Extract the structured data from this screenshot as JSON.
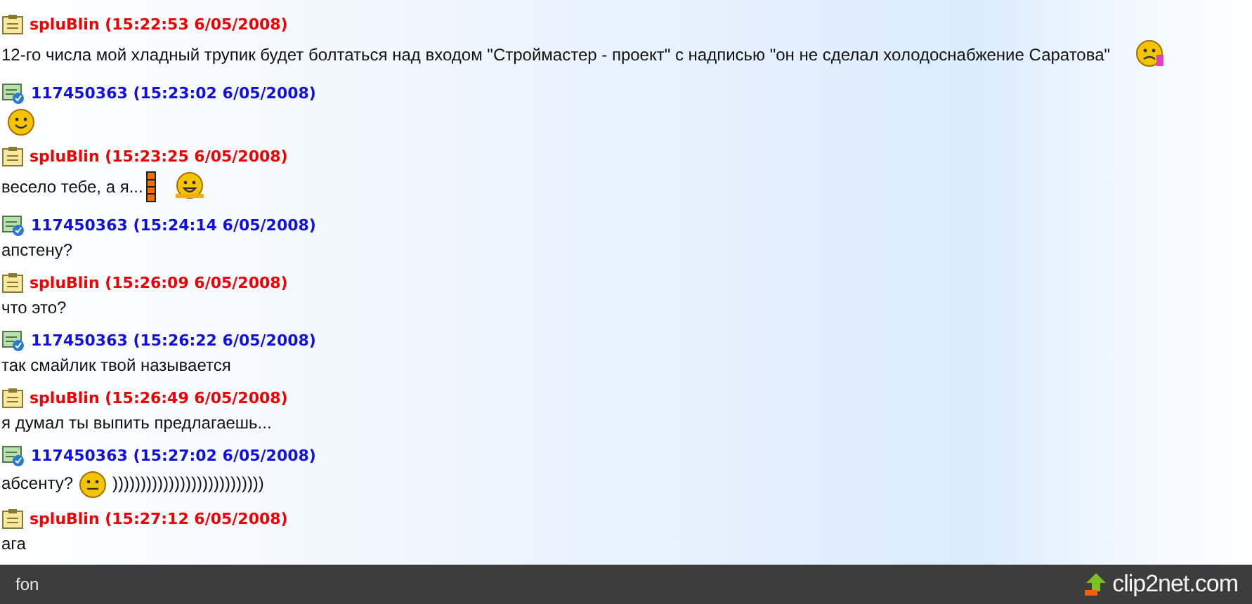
{
  "messages": [
    {
      "kind": "own",
      "header": "spluBlin (15:22:53 6/05/2008)",
      "parts": [
        {
          "kind": "text",
          "text": "12-го числа мой хладный трупик будет болтаться над входом \"Строймастер - проект\" с надписью \"он не сделал холодоснабжение Саратова\""
        },
        {
          "kind": "sad"
        }
      ]
    },
    {
      "kind": "peer",
      "header": "117450363 (15:23:02 6/05/2008)",
      "parts": [
        {
          "kind": "happy"
        }
      ]
    },
    {
      "kind": "own",
      "header": "spluBlin (15:23:25 6/05/2008)",
      "parts": [
        {
          "kind": "text",
          "text": "весело тебе, а я..."
        },
        {
          "kind": "bar"
        },
        {
          "kind": "laugh"
        }
      ]
    },
    {
      "kind": "peer",
      "header": "117450363 (15:24:14 6/05/2008)",
      "parts": [
        {
          "kind": "text",
          "text": "апстену?"
        }
      ]
    },
    {
      "kind": "own",
      "header": "spluBlin (15:26:09 6/05/2008)",
      "parts": [
        {
          "kind": "text",
          "text": "что это?"
        }
      ]
    },
    {
      "kind": "peer",
      "header": "117450363 (15:26:22 6/05/2008)",
      "parts": [
        {
          "kind": "text",
          "text": "так смайлик твой называется"
        }
      ]
    },
    {
      "kind": "own",
      "header": "spluBlin (15:26:49 6/05/2008)",
      "parts": [
        {
          "kind": "text",
          "text": "я думал ты выпить предлагаешь..."
        }
      ]
    },
    {
      "kind": "peer",
      "header": "117450363 (15:27:02 6/05/2008)",
      "parts": [
        {
          "kind": "text",
          "text": "абсенту?"
        },
        {
          "kind": "wide"
        },
        {
          "kind": "text",
          "text": ")))))))))))))))))))))))))))"
        }
      ]
    },
    {
      "kind": "own",
      "header": "spluBlin (15:27:12 6/05/2008)",
      "parts": [
        {
          "kind": "text",
          "text": "ага"
        }
      ]
    }
  ],
  "footer": {
    "title": "fon",
    "brand": "clip2net.com"
  }
}
